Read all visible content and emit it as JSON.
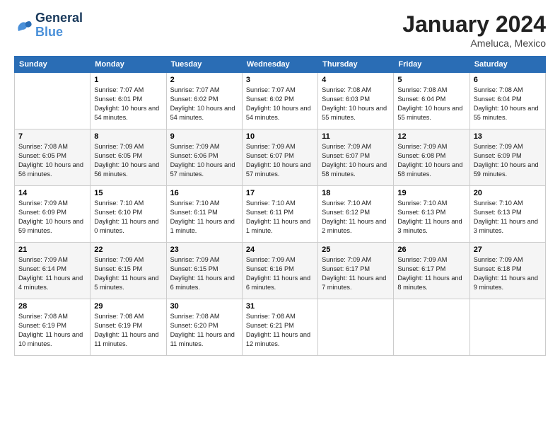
{
  "header": {
    "logo_line1": "General",
    "logo_line2": "Blue",
    "month": "January 2024",
    "location": "Ameluca, Mexico"
  },
  "weekdays": [
    "Sunday",
    "Monday",
    "Tuesday",
    "Wednesday",
    "Thursday",
    "Friday",
    "Saturday"
  ],
  "weeks": [
    [
      {
        "day": "",
        "info": ""
      },
      {
        "day": "1",
        "info": "Sunrise: 7:07 AM\nSunset: 6:01 PM\nDaylight: 10 hours\nand 54 minutes."
      },
      {
        "day": "2",
        "info": "Sunrise: 7:07 AM\nSunset: 6:02 PM\nDaylight: 10 hours\nand 54 minutes."
      },
      {
        "day": "3",
        "info": "Sunrise: 7:07 AM\nSunset: 6:02 PM\nDaylight: 10 hours\nand 54 minutes."
      },
      {
        "day": "4",
        "info": "Sunrise: 7:08 AM\nSunset: 6:03 PM\nDaylight: 10 hours\nand 55 minutes."
      },
      {
        "day": "5",
        "info": "Sunrise: 7:08 AM\nSunset: 6:04 PM\nDaylight: 10 hours\nand 55 minutes."
      },
      {
        "day": "6",
        "info": "Sunrise: 7:08 AM\nSunset: 6:04 PM\nDaylight: 10 hours\nand 55 minutes."
      }
    ],
    [
      {
        "day": "7",
        "info": "Sunrise: 7:08 AM\nSunset: 6:05 PM\nDaylight: 10 hours\nand 56 minutes."
      },
      {
        "day": "8",
        "info": "Sunrise: 7:09 AM\nSunset: 6:05 PM\nDaylight: 10 hours\nand 56 minutes."
      },
      {
        "day": "9",
        "info": "Sunrise: 7:09 AM\nSunset: 6:06 PM\nDaylight: 10 hours\nand 57 minutes."
      },
      {
        "day": "10",
        "info": "Sunrise: 7:09 AM\nSunset: 6:07 PM\nDaylight: 10 hours\nand 57 minutes."
      },
      {
        "day": "11",
        "info": "Sunrise: 7:09 AM\nSunset: 6:07 PM\nDaylight: 10 hours\nand 58 minutes."
      },
      {
        "day": "12",
        "info": "Sunrise: 7:09 AM\nSunset: 6:08 PM\nDaylight: 10 hours\nand 58 minutes."
      },
      {
        "day": "13",
        "info": "Sunrise: 7:09 AM\nSunset: 6:09 PM\nDaylight: 10 hours\nand 59 minutes."
      }
    ],
    [
      {
        "day": "14",
        "info": "Sunrise: 7:09 AM\nSunset: 6:09 PM\nDaylight: 10 hours\nand 59 minutes."
      },
      {
        "day": "15",
        "info": "Sunrise: 7:10 AM\nSunset: 6:10 PM\nDaylight: 11 hours\nand 0 minutes."
      },
      {
        "day": "16",
        "info": "Sunrise: 7:10 AM\nSunset: 6:11 PM\nDaylight: 11 hours\nand 1 minute."
      },
      {
        "day": "17",
        "info": "Sunrise: 7:10 AM\nSunset: 6:11 PM\nDaylight: 11 hours\nand 1 minute."
      },
      {
        "day": "18",
        "info": "Sunrise: 7:10 AM\nSunset: 6:12 PM\nDaylight: 11 hours\nand 2 minutes."
      },
      {
        "day": "19",
        "info": "Sunrise: 7:10 AM\nSunset: 6:13 PM\nDaylight: 11 hours\nand 3 minutes."
      },
      {
        "day": "20",
        "info": "Sunrise: 7:10 AM\nSunset: 6:13 PM\nDaylight: 11 hours\nand 3 minutes."
      }
    ],
    [
      {
        "day": "21",
        "info": "Sunrise: 7:09 AM\nSunset: 6:14 PM\nDaylight: 11 hours\nand 4 minutes."
      },
      {
        "day": "22",
        "info": "Sunrise: 7:09 AM\nSunset: 6:15 PM\nDaylight: 11 hours\nand 5 minutes."
      },
      {
        "day": "23",
        "info": "Sunrise: 7:09 AM\nSunset: 6:15 PM\nDaylight: 11 hours\nand 6 minutes."
      },
      {
        "day": "24",
        "info": "Sunrise: 7:09 AM\nSunset: 6:16 PM\nDaylight: 11 hours\nand 6 minutes."
      },
      {
        "day": "25",
        "info": "Sunrise: 7:09 AM\nSunset: 6:17 PM\nDaylight: 11 hours\nand 7 minutes."
      },
      {
        "day": "26",
        "info": "Sunrise: 7:09 AM\nSunset: 6:17 PM\nDaylight: 11 hours\nand 8 minutes."
      },
      {
        "day": "27",
        "info": "Sunrise: 7:09 AM\nSunset: 6:18 PM\nDaylight: 11 hours\nand 9 minutes."
      }
    ],
    [
      {
        "day": "28",
        "info": "Sunrise: 7:08 AM\nSunset: 6:19 PM\nDaylight: 11 hours\nand 10 minutes."
      },
      {
        "day": "29",
        "info": "Sunrise: 7:08 AM\nSunset: 6:19 PM\nDaylight: 11 hours\nand 11 minutes."
      },
      {
        "day": "30",
        "info": "Sunrise: 7:08 AM\nSunset: 6:20 PM\nDaylight: 11 hours\nand 11 minutes."
      },
      {
        "day": "31",
        "info": "Sunrise: 7:08 AM\nSunset: 6:21 PM\nDaylight: 11 hours\nand 12 minutes."
      },
      {
        "day": "",
        "info": ""
      },
      {
        "day": "",
        "info": ""
      },
      {
        "day": "",
        "info": ""
      }
    ]
  ]
}
